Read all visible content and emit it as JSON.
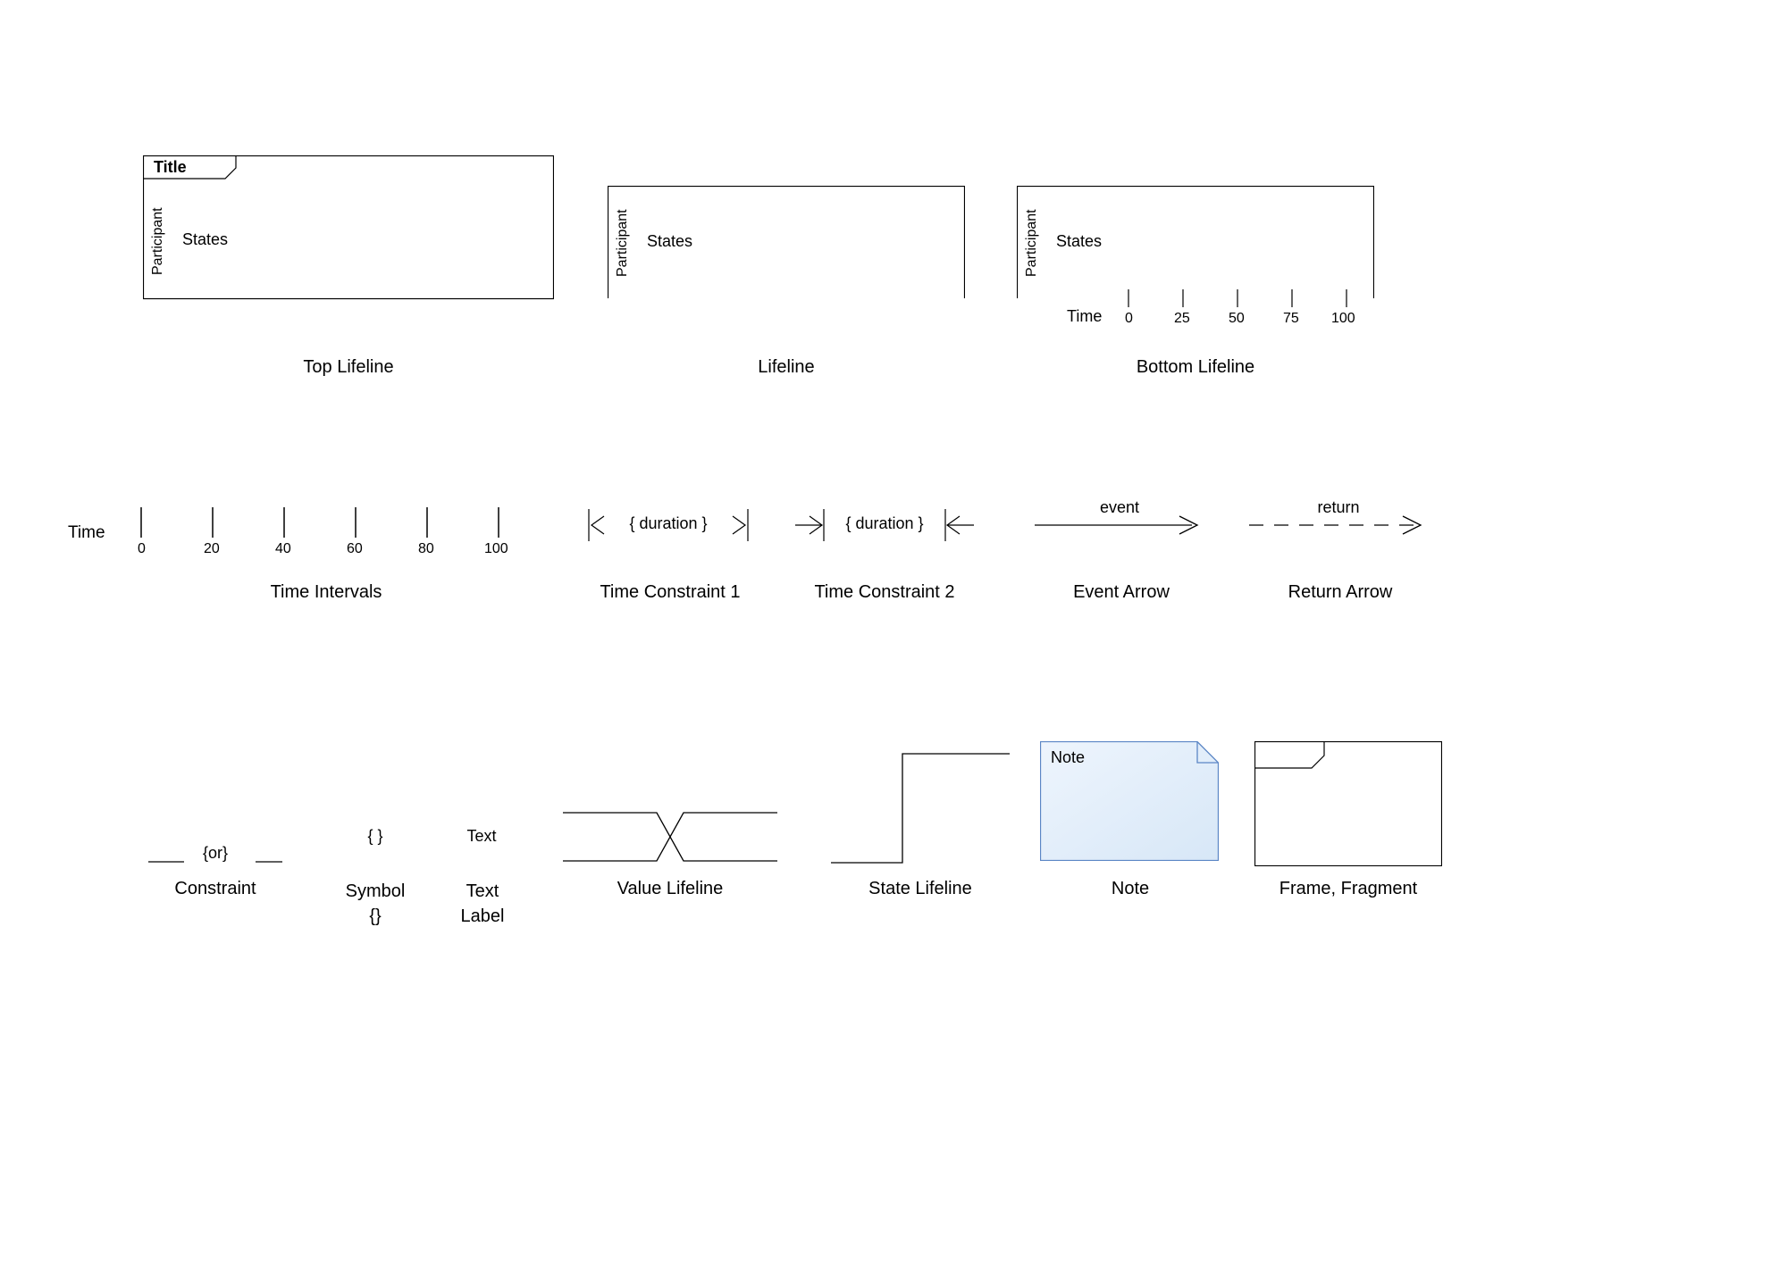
{
  "topLifeline": {
    "title": "Title",
    "participant": "Participant",
    "states": "States",
    "caption": "Top Lifeline"
  },
  "lifeline": {
    "participant": "Participant",
    "states": "States",
    "caption": "Lifeline"
  },
  "bottomLifeline": {
    "participant": "Participant",
    "states": "States",
    "timeLabel": "Time",
    "ticks": [
      "0",
      "25",
      "50",
      "75",
      "100"
    ],
    "caption": "Bottom Lifeline"
  },
  "timeIntervals": {
    "label": "Time",
    "ticks": [
      "0",
      "20",
      "40",
      "60",
      "80",
      "100"
    ],
    "caption": "Time Intervals"
  },
  "timeConstraint1": {
    "text": "{ duration }",
    "caption": "Time Constraint 1"
  },
  "timeConstraint2": {
    "text": "{ duration }",
    "caption": "Time Constraint 2"
  },
  "eventArrow": {
    "text": "event",
    "caption": "Event Arrow"
  },
  "returnArrow": {
    "text": "return",
    "caption": "Return Arrow"
  },
  "constraint": {
    "text": "{or}",
    "caption": "Constraint"
  },
  "symbol": {
    "text": "{ }",
    "caption": "Symbol\n{}"
  },
  "textLabel": {
    "text": "Text",
    "caption": "Text\nLabel"
  },
  "valueLifeline": {
    "caption": "Value Lifeline"
  },
  "stateLifeline": {
    "caption": "State Lifeline"
  },
  "note": {
    "text": "Note",
    "caption": "Note"
  },
  "frame": {
    "caption": "Frame, Fragment"
  }
}
